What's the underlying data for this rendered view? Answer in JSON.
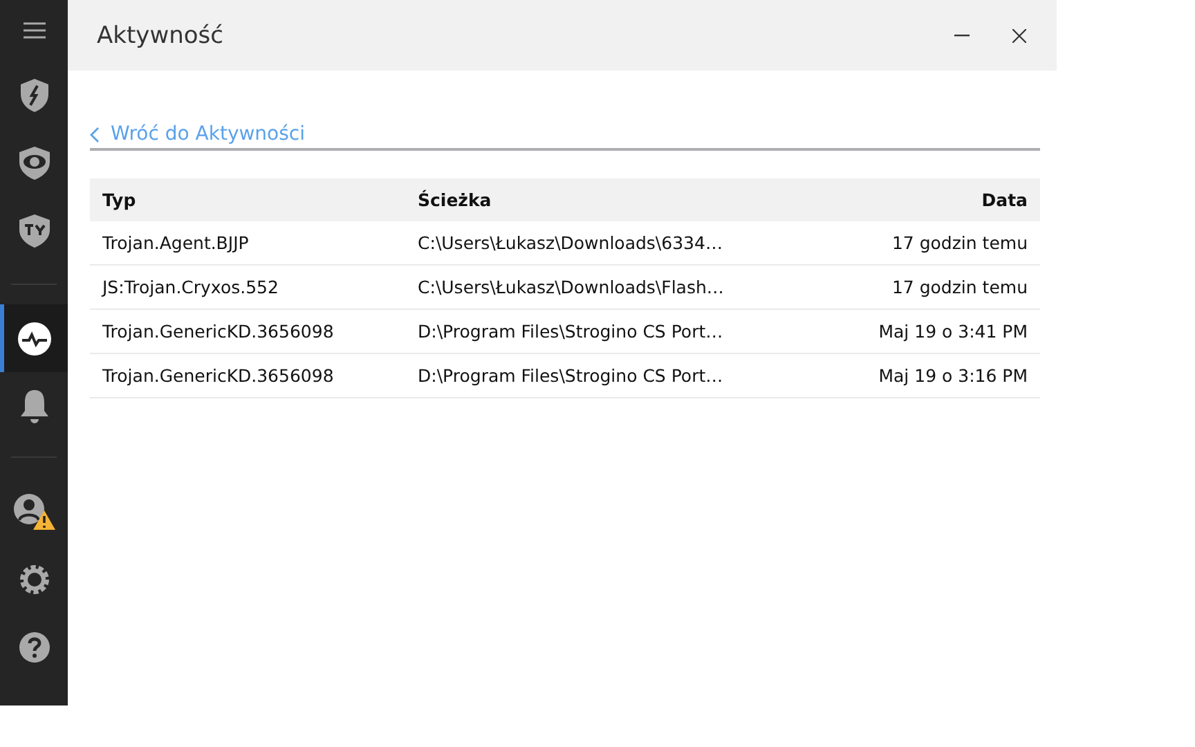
{
  "sidebar": {
    "groups": [
      {
        "items": [
          {
            "selected": false
          },
          {
            "selected": false
          },
          {
            "selected": false
          },
          {
            "selected": false
          }
        ]
      },
      {
        "items": [
          {
            "selected": true
          },
          {
            "selected": false
          }
        ]
      },
      {
        "items": [
          {
            "selected": false
          },
          {
            "selected": false
          },
          {
            "selected": false
          }
        ]
      }
    ]
  },
  "window": {
    "title": "Aktywność"
  },
  "back_link": {
    "label": "Wróć do Aktywności"
  },
  "table": {
    "columns": [
      "Typ",
      "Ścieżka",
      "Data"
    ],
    "rows": [
      [
        "Trojan.Agent.BJJP",
        "C:\\Users\\Łukasz\\Downloads\\6334…",
        "17 godzin temu"
      ],
      [
        "JS:Trojan.Cryxos.552",
        "C:\\Users\\Łukasz\\Downloads\\Flash…",
        "17 godzin temu"
      ],
      [
        "Trojan.GenericKD.3656098",
        "D:\\Program Files\\Strogino CS Port…",
        "Maj 19 o 3:41 PM"
      ],
      [
        "Trojan.GenericKD.3656098",
        "D:\\Program Files\\Strogino CS Port…",
        "Maj 19 o 3:16 PM"
      ]
    ]
  }
}
